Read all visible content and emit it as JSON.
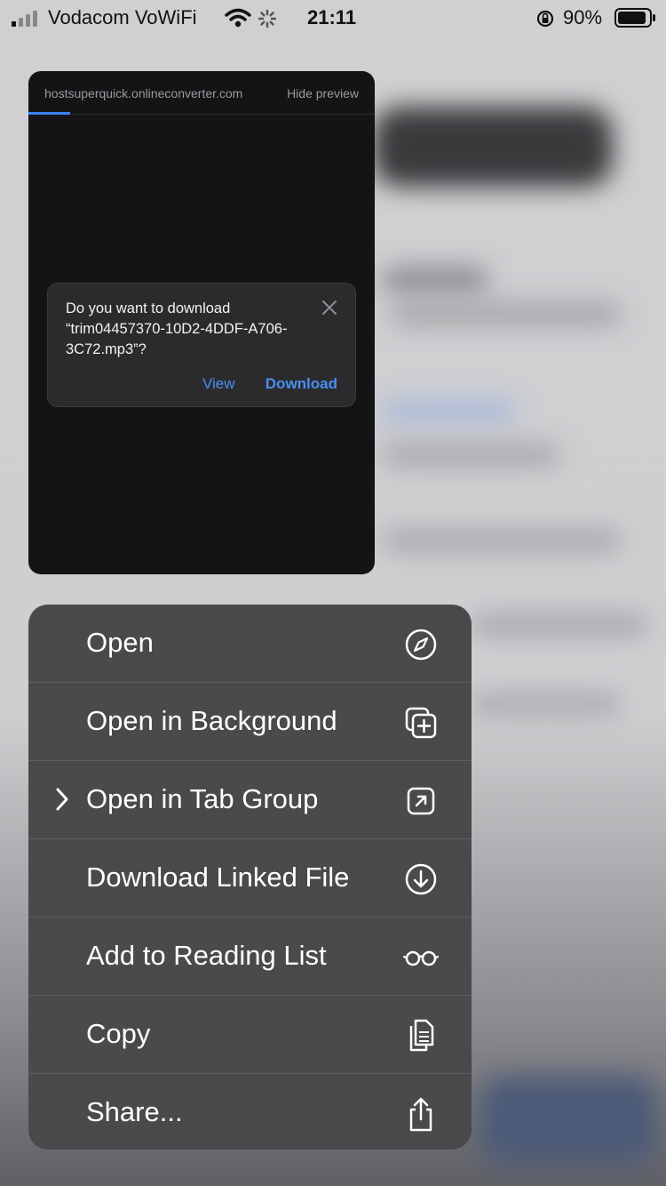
{
  "status_bar": {
    "carrier": "Vodacom VoWiFi",
    "time": "21:11",
    "battery": "90%"
  },
  "preview": {
    "url": "hostsuperquick.onlineconverter.com",
    "hide_label": "Hide preview",
    "dialog": {
      "message": "Do you want to download “trim04457370-10D2-4DDF-A706-3C72.mp3”?",
      "view_label": "View",
      "download_label": "Download"
    }
  },
  "menu": {
    "items": [
      {
        "label": "Open",
        "icon": "compass-icon"
      },
      {
        "label": "Open in Background",
        "icon": "plus-square-icon"
      },
      {
        "label": "Open in Tab Group",
        "icon": "arrow-square-icon",
        "has_submenu": true
      },
      {
        "label": "Download Linked File",
        "icon": "download-circle-icon"
      },
      {
        "label": "Add to Reading List",
        "icon": "glasses-icon"
      },
      {
        "label": "Copy",
        "icon": "copy-icon"
      },
      {
        "label": "Share...",
        "icon": "share-icon"
      }
    ]
  },
  "colors": {
    "accent": "#4a8ff0",
    "menu_bg": "#4a4a4d",
    "preview_bg": "#141416"
  }
}
